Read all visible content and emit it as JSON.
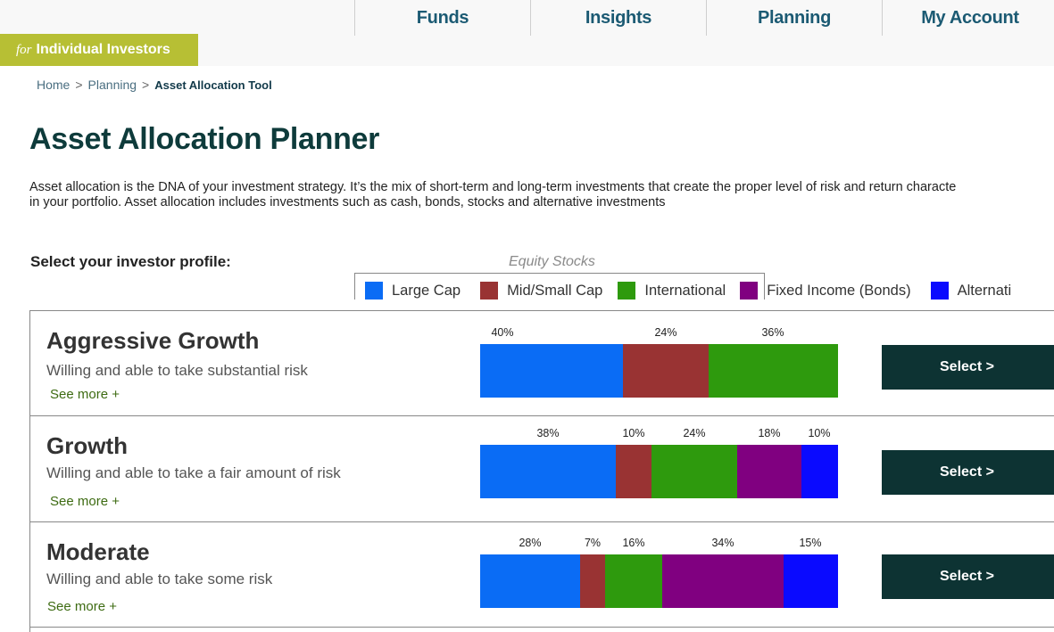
{
  "nav": {
    "items": [
      {
        "label": "Funds"
      },
      {
        "label": "Insights"
      },
      {
        "label": "Planning"
      },
      {
        "label": "My Account"
      }
    ]
  },
  "brand": {
    "prefix": "for",
    "label": "Individual Investors"
  },
  "breadcrumb": {
    "home": "Home",
    "planning": "Planning",
    "current": "Asset Allocation Tool",
    "separator": ">"
  },
  "page": {
    "title": "Asset Allocation Planner",
    "intro_line1": "Asset allocation is the DNA of your investment strategy. It’s the mix of short-term and long-term investments that create the proper level of risk and return characte",
    "intro_line2": "in your portfolio. Asset allocation includes investments such as cash, bonds, stocks and alternative investments"
  },
  "selector": {
    "label": "Select your investor profile:",
    "group_label": "Equity Stocks"
  },
  "legend": [
    {
      "label": "Large Cap",
      "color": "#0a6cf5"
    },
    {
      "label": "Mid/Small Cap",
      "color": "#993333"
    },
    {
      "label": "International",
      "color": "#2e9a0d"
    },
    {
      "label": "Fixed Income (Bonds)",
      "color": "#800080"
    },
    {
      "label": "Alternati",
      "color": "#0a0aff"
    }
  ],
  "chart_data": [
    {
      "type": "bar",
      "stacked": true,
      "orientation": "horizontal",
      "profile": "Aggressive Growth",
      "categories": [
        "Large Cap",
        "Mid/Small Cap",
        "International"
      ],
      "values": [
        40,
        24,
        36
      ],
      "labels": [
        "40%",
        "24%",
        "36%"
      ]
    },
    {
      "type": "bar",
      "stacked": true,
      "orientation": "horizontal",
      "profile": "Growth",
      "categories": [
        "Large Cap",
        "Mid/Small Cap",
        "International",
        "Fixed Income (Bonds)",
        "Alternatives"
      ],
      "values": [
        38,
        10,
        24,
        18,
        10
      ],
      "labels": [
        "38%",
        "10%",
        "24%",
        "18%",
        "10%"
      ]
    },
    {
      "type": "bar",
      "stacked": true,
      "orientation": "horizontal",
      "profile": "Moderate",
      "categories": [
        "Large Cap",
        "Mid/Small Cap",
        "International",
        "Fixed Income (Bonds)",
        "Alternatives"
      ],
      "values": [
        28,
        7,
        16,
        34,
        15
      ],
      "labels": [
        "28%",
        "7%",
        "16%",
        "34%",
        "15%"
      ]
    }
  ],
  "profiles": [
    {
      "name": "Aggressive Growth",
      "description": "Willing and able to take substantial risk",
      "more": "See more +",
      "button": "Select >"
    },
    {
      "name": "Growth",
      "description": "Willing and able to take a fair amount of risk",
      "more": "See more +",
      "button": "Select >"
    },
    {
      "name": "Moderate",
      "description": "Willing and able to take some risk",
      "more": "See more +",
      "button": "Select >"
    }
  ]
}
